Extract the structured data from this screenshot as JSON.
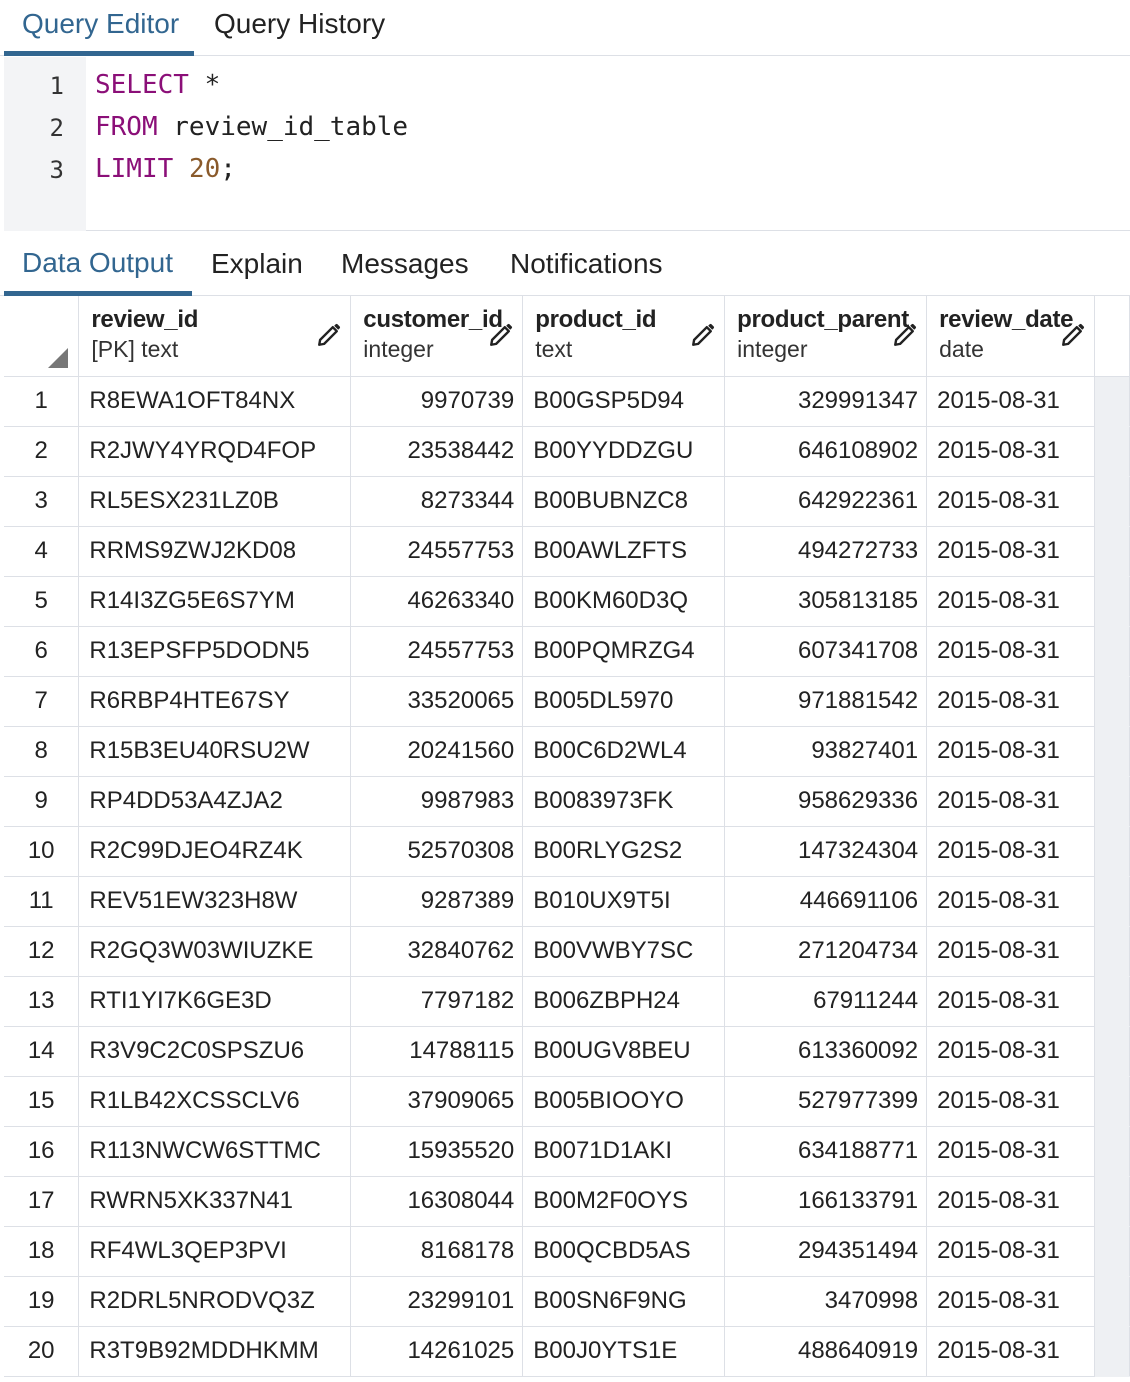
{
  "top_tabs": {
    "query_editor": "Query Editor",
    "query_history": "Query History"
  },
  "editor": {
    "line_numbers": [
      "1",
      "2",
      "3"
    ],
    "lines": [
      {
        "kw": "SELECT",
        "rest": " *"
      },
      {
        "kw": "FROM",
        "rest": " review_id_table"
      },
      {
        "kw": "LIMIT",
        "num": "20",
        "rest": ";"
      }
    ]
  },
  "output_tabs": {
    "data_output": "Data Output",
    "explain": "Explain",
    "messages": "Messages",
    "notifications": "Notifications"
  },
  "columns": [
    {
      "name": "review_id",
      "type": "[PK] text"
    },
    {
      "name": "customer_id",
      "type": "integer"
    },
    {
      "name": "product_id",
      "type": "text"
    },
    {
      "name": "product_parent",
      "type": "integer"
    },
    {
      "name": "review_date",
      "type": "date"
    }
  ],
  "rows": [
    [
      "1",
      "R8EWA1OFT84NX",
      "9970739",
      "B00GSP5D94",
      "329991347",
      "2015-08-31"
    ],
    [
      "2",
      "R2JWY4YRQD4FOP",
      "23538442",
      "B00YYDDZGU",
      "646108902",
      "2015-08-31"
    ],
    [
      "3",
      "RL5ESX231LZ0B",
      "8273344",
      "B00BUBNZC8",
      "642922361",
      "2015-08-31"
    ],
    [
      "4",
      "RRMS9ZWJ2KD08",
      "24557753",
      "B00AWLZFTS",
      "494272733",
      "2015-08-31"
    ],
    [
      "5",
      "R14I3ZG5E6S7YM",
      "46263340",
      "B00KM60D3Q",
      "305813185",
      "2015-08-31"
    ],
    [
      "6",
      "R13EPSFP5DODN5",
      "24557753",
      "B00PQMRZG4",
      "607341708",
      "2015-08-31"
    ],
    [
      "7",
      "R6RBP4HTE67SY",
      "33520065",
      "B005DL5970",
      "971881542",
      "2015-08-31"
    ],
    [
      "8",
      "R15B3EU40RSU2W",
      "20241560",
      "B00C6D2WL4",
      "93827401",
      "2015-08-31"
    ],
    [
      "9",
      "RP4DD53A4ZJA2",
      "9987983",
      "B0083973FK",
      "958629336",
      "2015-08-31"
    ],
    [
      "10",
      "R2C99DJEO4RZ4K",
      "52570308",
      "B00RLYG2S2",
      "147324304",
      "2015-08-31"
    ],
    [
      "11",
      "REV51EW323H8W",
      "9287389",
      "B010UX9T5I",
      "446691106",
      "2015-08-31"
    ],
    [
      "12",
      "R2GQ3W03WIUZKE",
      "32840762",
      "B00VWBY7SC",
      "271204734",
      "2015-08-31"
    ],
    [
      "13",
      "RTI1YI7K6GE3D",
      "7797182",
      "B006ZBPH24",
      "67911244",
      "2015-08-31"
    ],
    [
      "14",
      "R3V9C2C0SPSZU6",
      "14788115",
      "B00UGV8BEU",
      "613360092",
      "2015-08-31"
    ],
    [
      "15",
      "R1LB42XCSSCLV6",
      "37909065",
      "B005BIOOYO",
      "527977399",
      "2015-08-31"
    ],
    [
      "16",
      "R113NWCW6STTMC",
      "15935520",
      "B0071D1AKI",
      "634188771",
      "2015-08-31"
    ],
    [
      "17",
      "RWRN5XK337N41",
      "16308044",
      "B00M2F0OYS",
      "166133791",
      "2015-08-31"
    ],
    [
      "18",
      "RF4WL3QEP3PVI",
      "8168178",
      "B00QCBD5AS",
      "294351494",
      "2015-08-31"
    ],
    [
      "19",
      "R2DRL5NRODVQ3Z",
      "23299101",
      "B00SN6F9NG",
      "3470998",
      "2015-08-31"
    ],
    [
      "20",
      "R3T9B92MDDHKMM",
      "14261025",
      "B00J0YTS1E",
      "488640919",
      "2015-08-31"
    ]
  ],
  "icons": {
    "edit": "pencil-icon",
    "sort_corner": "triangle-corner-icon"
  },
  "colors": {
    "accent": "#326690",
    "keyword": "#8b0f78",
    "number": "#8a5a2b",
    "gutter": "#f3f4f6",
    "grid_line": "#dde0e6"
  }
}
